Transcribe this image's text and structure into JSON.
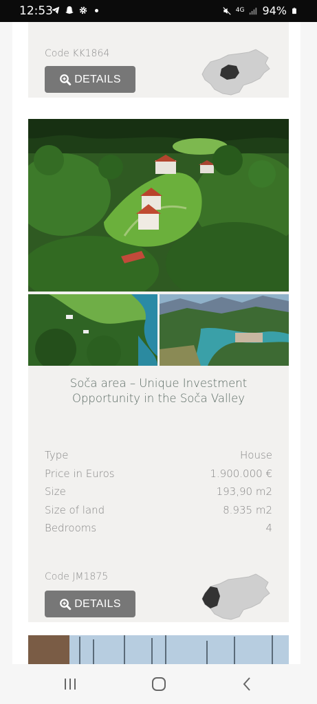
{
  "status_bar": {
    "time": "12:53",
    "left_icons": [
      "telegram-icon",
      "snapchat-icon",
      "settings-icon"
    ],
    "right_icons": [
      "mute-icon",
      "4g-icon",
      "signal-icon",
      "battery-icon"
    ],
    "network": "4G",
    "battery": "94%"
  },
  "listings": [
    {
      "code": "Code KK1864",
      "details_label": "DETAILS",
      "map_highlight": "central"
    },
    {
      "title": "Soča area – Unique Investment Opportunity in the Soča Valley",
      "specs": [
        {
          "label": "Type",
          "value": "House"
        },
        {
          "label": "Price in Euros",
          "value": "1.900.000 €"
        },
        {
          "label": "Size",
          "value": "193,90 m2"
        },
        {
          "label": "Size of land",
          "value": "8.935 m2"
        },
        {
          "label": "Bedrooms",
          "value": "4"
        }
      ],
      "code": "Code JM1875",
      "details_label": "DETAILS",
      "map_highlight": "west"
    }
  ],
  "colors": {
    "card_bg": "#f2f1ef",
    "button_bg": "#777777",
    "title_text": "#5a6a63"
  },
  "nav_bar": {
    "buttons": [
      "recent-apps",
      "home",
      "back"
    ]
  }
}
